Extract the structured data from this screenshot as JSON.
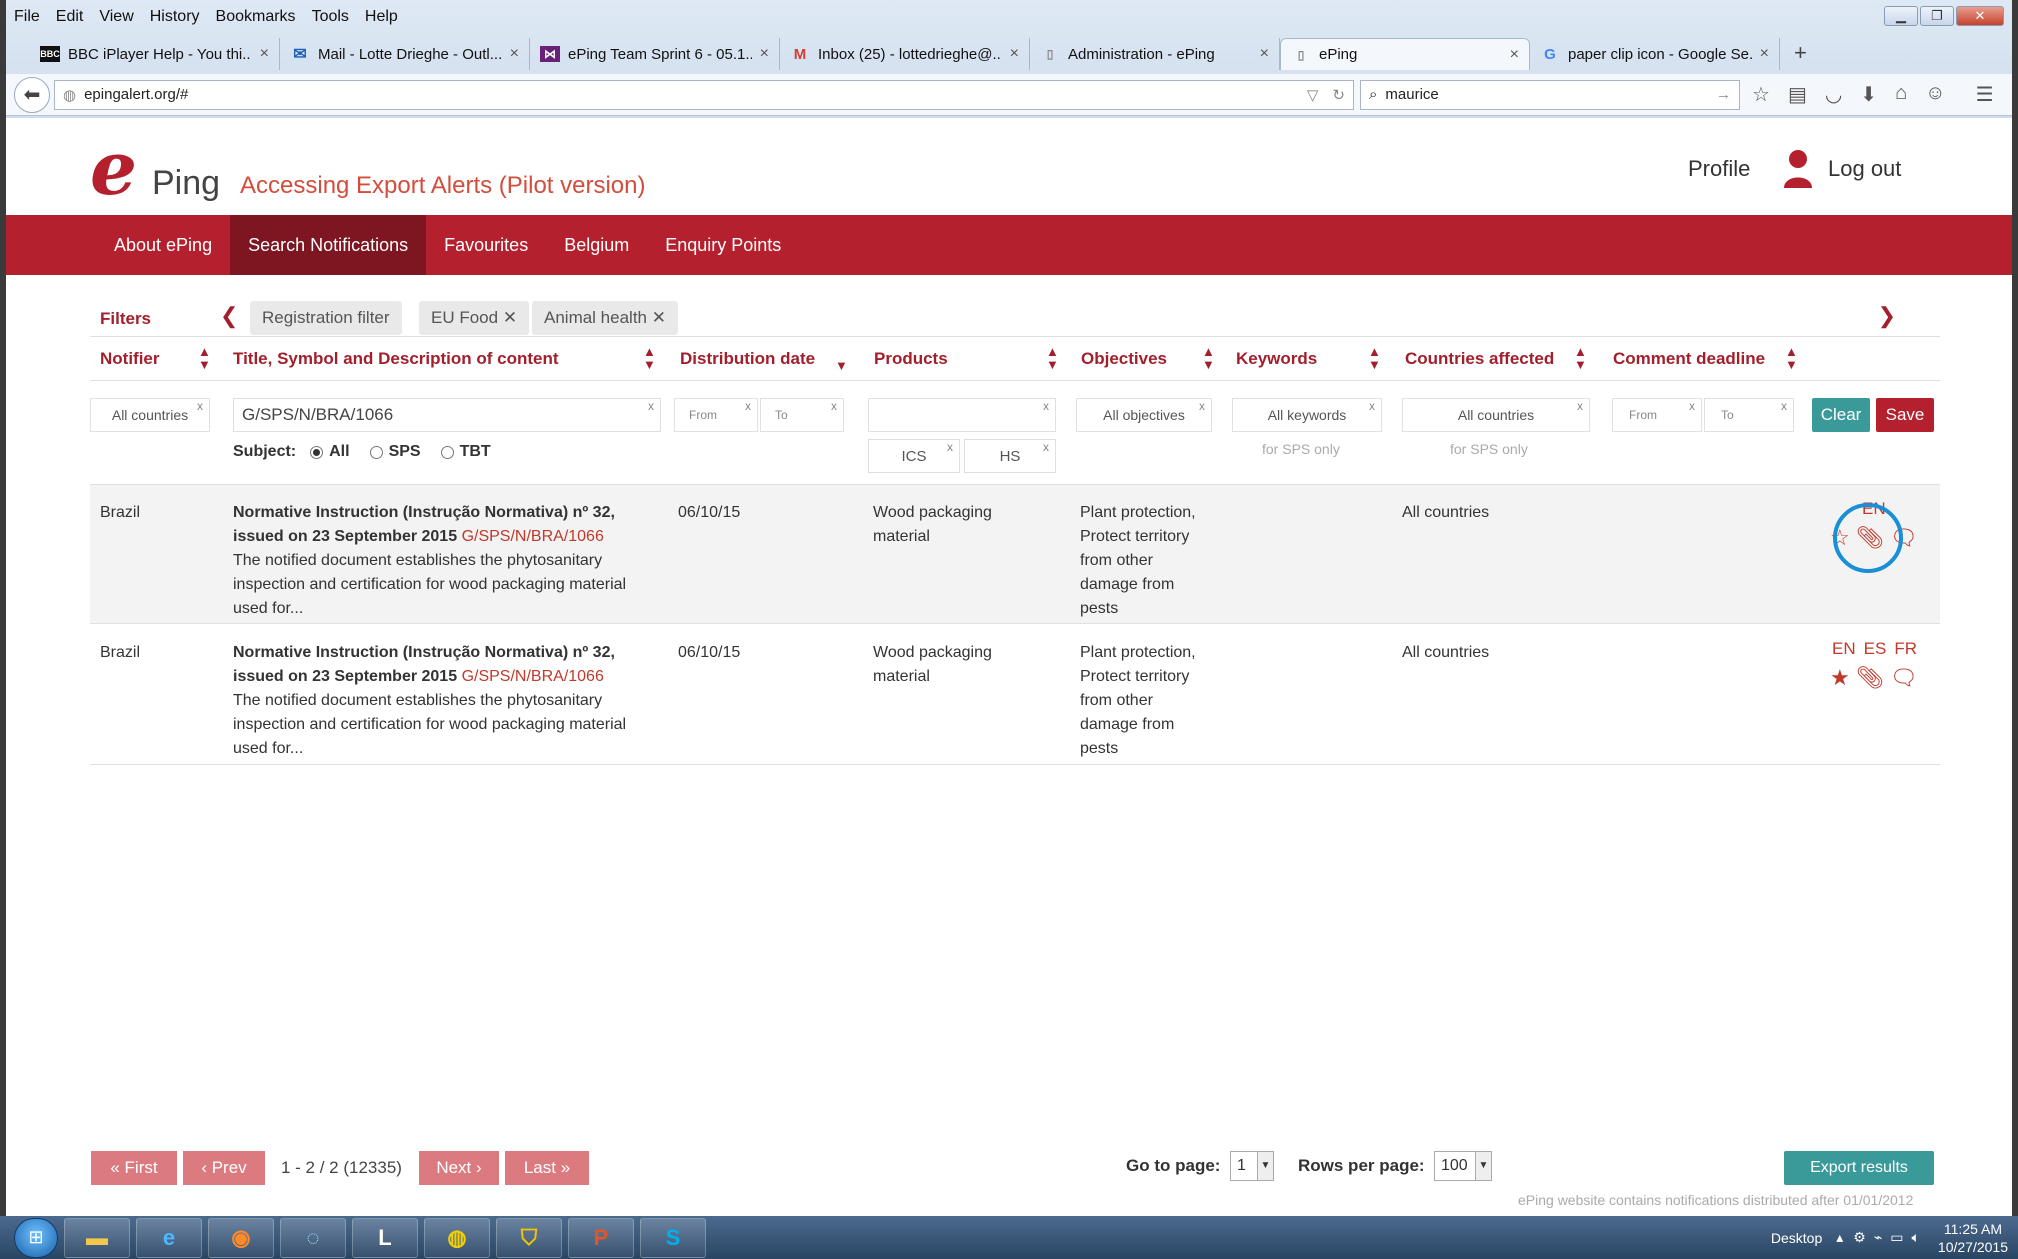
{
  "browser": {
    "menu": [
      "File",
      "Edit",
      "View",
      "History",
      "Bookmarks",
      "Tools",
      "Help"
    ],
    "tabs": [
      {
        "icon": "BBC",
        "label": "BBC iPlayer Help - You thi..."
      },
      {
        "icon": "✉",
        "label": "Mail - Lotte Drieghe - Outl..."
      },
      {
        "icon": "⋈",
        "label": "ePing Team Sprint 6 - 05.1..."
      },
      {
        "icon": "M",
        "label": "Inbox (25) - lottedrieghe@..."
      },
      {
        "icon": "▯",
        "label": "Administration - ePing"
      },
      {
        "icon": "▯",
        "label": "ePing"
      },
      {
        "icon": "G",
        "label": "paper clip icon - Google Se..."
      }
    ],
    "url": "epingalert.org/#",
    "search_value": "maurice"
  },
  "header": {
    "logo_e": "e",
    "logo_ping": "Ping",
    "subtitle": "Accessing Export Alerts (Pilot version)",
    "profile": "Profile",
    "logout": "Log out"
  },
  "nav": [
    "About ePing",
    "Search Notifications",
    "Favourites",
    "Belgium",
    "Enquiry Points"
  ],
  "filters": {
    "label": "Filters",
    "chips": [
      {
        "label": "Registration filter",
        "closable": false
      },
      {
        "label": "EU Food",
        "closable": true
      },
      {
        "label": "Animal health",
        "closable": true
      }
    ]
  },
  "columns": [
    "Notifier",
    "Title, Symbol and Description of content",
    "Distribution date",
    "Products",
    "Objectives",
    "Keywords",
    "Countries affected",
    "Comment deadline"
  ],
  "filter_inputs": {
    "notifier": "All countries",
    "title": "G/SPS/N/BRA/1066",
    "date_from": "From",
    "date_to": "To",
    "products": "",
    "ics": "ICS",
    "hs": "HS",
    "objectives": "All objectives",
    "keywords": "All keywords",
    "keywords_hint": "for SPS only",
    "countries": "All countries",
    "countries_hint": "for SPS only",
    "deadline_from": "From",
    "deadline_to": "To",
    "subject_label": "Subject:",
    "subject_options": [
      "All",
      "SPS",
      "TBT"
    ],
    "clear": "Clear",
    "save": "Save"
  },
  "rows": [
    {
      "notifier": "Brazil",
      "title": "Normative Instruction (Instrução Normativa) nº 32, issued on 23 September 2015",
      "symbol": "G/SPS/N/BRA/1066",
      "description": "The notified document establishes the phytosanitary inspection and certification for wood packaging material used for...",
      "date": "06/10/15",
      "products": "Wood packaging material",
      "objectives": "Plant protection, Protect territory from other damage from pests",
      "countries": "All countries",
      "langs": [
        "EN"
      ],
      "favourite": false
    },
    {
      "notifier": "Brazil",
      "title": "Normative Instruction (Instrução Normativa) nº 32, issued on 23 September 2015",
      "symbol": "G/SPS/N/BRA/1066",
      "description": "The notified document establishes the phytosanitary inspection and certification for wood packaging material used for...",
      "date": "06/10/15",
      "products": "Wood packaging material",
      "objectives": "Plant protection, Protect territory from other damage from pests",
      "countries": "All countries",
      "langs": [
        "EN",
        "ES",
        "FR"
      ],
      "favourite": true
    }
  ],
  "pagination": {
    "first": "« First",
    "prev": "‹ Prev",
    "info": "1 - 2 / 2 (12335)",
    "next": "Next ›",
    "last": "Last »",
    "goto_label": "Go to page:",
    "goto_value": "1",
    "rows_label": "Rows per page:",
    "rows_value": "100",
    "export": "Export results",
    "footnote": "ePing website contains notifications distributed after 01/01/2012"
  },
  "taskbar": {
    "desktop": "Desktop",
    "time": "11:25 AM",
    "date": "10/27/2015"
  },
  "colors": {
    "brand_red": "#b5202e",
    "active_nav": "#7d1620",
    "teal": "#3a9a9a",
    "highlight_circle": "#1a8fd6"
  }
}
